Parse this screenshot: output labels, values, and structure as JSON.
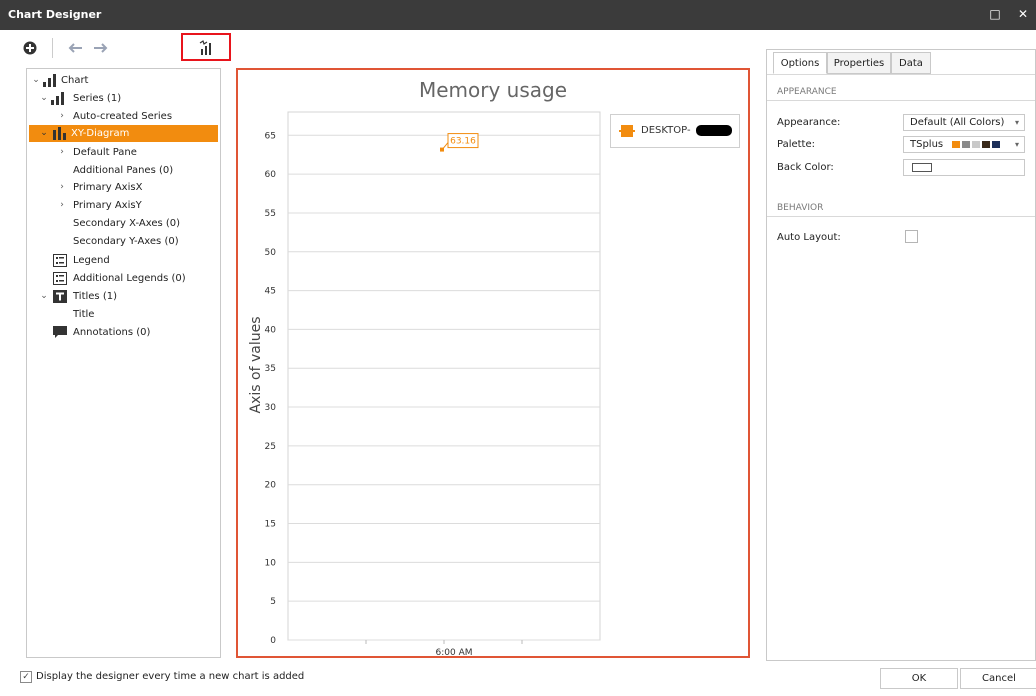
{
  "window": {
    "title": "Chart Designer",
    "maximize_glyph": "□",
    "close_glyph": "✕"
  },
  "toolbar": {
    "add_icon": "add-circle-icon",
    "undo_icon": "undo-icon",
    "redo_icon": "redo-icon",
    "wizard_icon": "chart-wizard-icon"
  },
  "tree": {
    "items": [
      {
        "label": "Chart",
        "icon": "bar-chart-icon",
        "expanded": true
      },
      {
        "label": "Series (1)",
        "icon": "bar-chart-icon",
        "expanded": true
      },
      {
        "label": "Auto-created Series",
        "collapsed": true
      },
      {
        "label": "XY-Diagram",
        "icon": "xy-diagram-icon",
        "expanded": true,
        "selected": true
      },
      {
        "label": "Default Pane",
        "collapsed": true
      },
      {
        "label": "Additional Panes (0)"
      },
      {
        "label": "Primary AxisX",
        "collapsed": true
      },
      {
        "label": "Primary AxisY",
        "collapsed": true
      },
      {
        "label": "Secondary X-Axes (0)"
      },
      {
        "label": "Secondary Y-Axes (0)"
      },
      {
        "label": "Legend",
        "icon": "legend-icon"
      },
      {
        "label": "Additional Legends (0)",
        "icon": "legend-icon"
      },
      {
        "label": "Titles (1)",
        "icon": "title-icon",
        "expanded": true
      },
      {
        "label": "Title"
      },
      {
        "label": "Annotations (0)",
        "icon": "annotation-icon"
      }
    ]
  },
  "chart_data": {
    "type": "line",
    "title": "Memory usage",
    "ylabel": "Axis of values",
    "xlabel": "",
    "categories": [
      "6:00 AM"
    ],
    "series": [
      {
        "name": "DESKTOP-",
        "values": [
          63.16
        ],
        "color": "#f28c0f"
      }
    ],
    "ylim": [
      0,
      68
    ],
    "yticks": [
      0,
      5,
      10,
      15,
      20,
      25,
      30,
      35,
      40,
      45,
      50,
      55,
      60,
      65
    ],
    "grid": true,
    "legend": "top-right",
    "data_labels": [
      "63.16"
    ]
  },
  "properties": {
    "tabs": [
      "Options",
      "Properties",
      "Data"
    ],
    "active_tab": "Options",
    "sections": {
      "appearance": "APPEARANCE",
      "behavior": "BEHAVIOR"
    },
    "appearance_label": "Appearance:",
    "appearance_value": "Default (All Colors)",
    "palette_label": "Palette:",
    "palette_value": "TSplus",
    "palette_colors": [
      "#f28c0f",
      "#8a8a8a",
      "#c9c9c9",
      "#3a2a1a",
      "#1c2f5a"
    ],
    "back_color_label": "Back Color:",
    "auto_layout_label": "Auto Layout:",
    "auto_layout_checked": false
  },
  "footer": {
    "checkbox_label": "Display the designer every time a new chart is added",
    "checkbox_checked": true,
    "ok_label": "OK",
    "cancel_label": "Cancel"
  }
}
